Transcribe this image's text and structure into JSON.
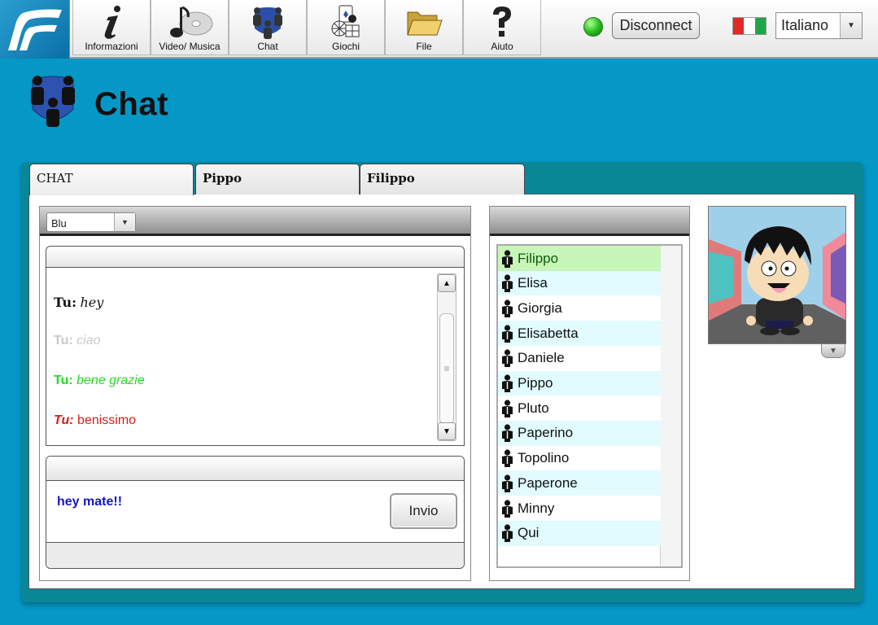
{
  "nav": {
    "tabs": [
      {
        "label": "Informazioni",
        "icon": "info-icon"
      },
      {
        "label": "Video/ Musica",
        "icon": "music-icon"
      },
      {
        "label": "Chat",
        "icon": "people-icon"
      },
      {
        "label": "Giochi",
        "icon": "games-icon"
      },
      {
        "label": "File",
        "icon": "folder-icon"
      },
      {
        "label": "Aiuto",
        "icon": "help-icon"
      }
    ]
  },
  "connection": {
    "status_color": "#27c21e",
    "disconnect_label": "Disconnect"
  },
  "language": {
    "selected": "Italiano",
    "flag_colors": [
      "#df2b24",
      "#ffffff",
      "#20a64a"
    ]
  },
  "page": {
    "title": "Chat"
  },
  "chat_tabs": [
    "CHAT",
    "Pippo",
    "Filippo"
  ],
  "chat": {
    "color_select": "Blu",
    "messages": [
      {
        "who": "Tu:",
        "text": "hey",
        "color": "#111111"
      },
      {
        "who": "Tu:",
        "text": "ciao",
        "color": "#c8c8c8"
      },
      {
        "who": "Tu:",
        "text": "bene grazie",
        "color": "#22dd22"
      },
      {
        "who": "Tu:",
        "text": "benissimo",
        "color": "#dd1a1a"
      }
    ],
    "input_text": "hey mate!!",
    "send_label": "Invio"
  },
  "users": [
    "Filippo",
    "Elisa",
    "Giorgia",
    "Elisabetta",
    "Daniele",
    "Pippo",
    "Pluto",
    "Paperino",
    "Topolino",
    "Paperone",
    "Minny",
    "Qui"
  ],
  "user_colors": {
    "selected": "#c8f5b8",
    "alt": "#e1fbff",
    "plain": "#ffffff"
  }
}
